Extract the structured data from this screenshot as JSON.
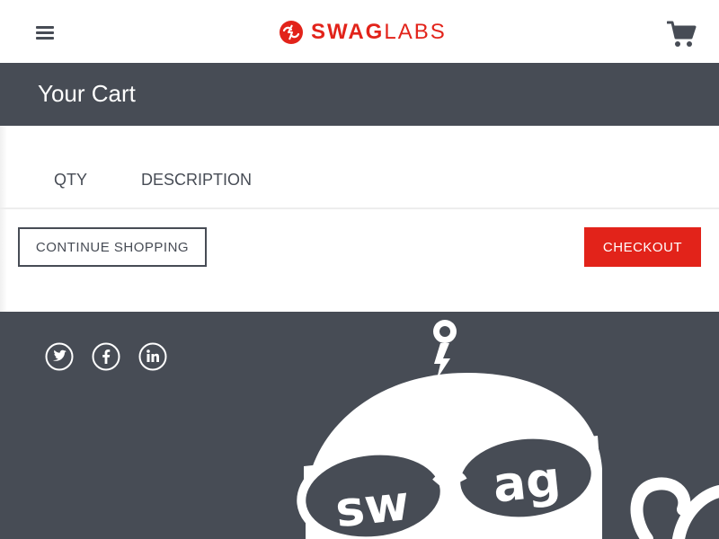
{
  "header": {
    "menu_icon": "hamburger-menu-icon",
    "logo": {
      "text_bold": "SWAG",
      "text_light": "LABS",
      "color": "#e2231a"
    },
    "cart_icon": "shopping-cart-icon"
  },
  "title_band": {
    "title": "Your Cart",
    "background": "#474c55"
  },
  "cart": {
    "columns": {
      "qty": "QTY",
      "description": "DESCRIPTION"
    },
    "items": []
  },
  "actions": {
    "continue_label": "CONTINUE SHOPPING",
    "checkout_label": "CHECKOUT",
    "checkout_color": "#e2231a"
  },
  "footer": {
    "background": "#474c55",
    "social": [
      {
        "icon": "twitter-icon"
      },
      {
        "icon": "facebook-icon"
      },
      {
        "icon": "linkedin-icon"
      }
    ],
    "mascot_text": "swag"
  }
}
